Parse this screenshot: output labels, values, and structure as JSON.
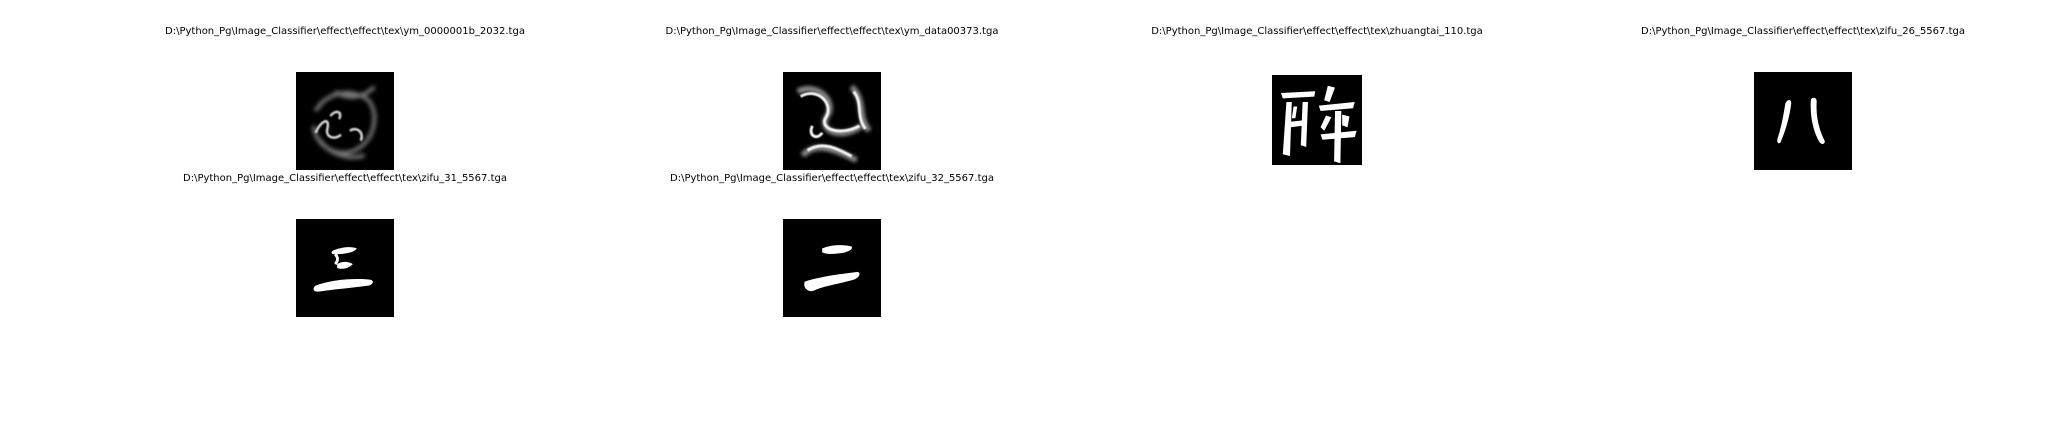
{
  "figure": {
    "images": [
      {
        "path": "D:\\Python_Pg\\Image_Classifier\\effect\\effect\\tex\\ym_0000001b_2032.tga",
        "thumb": "smoke-texture-1"
      },
      {
        "path": "D:\\Python_Pg\\Image_Classifier\\effect\\effect\\tex\\ym_data00373.tga",
        "thumb": "smoke-texture-2"
      },
      {
        "path": "D:\\Python_Pg\\Image_Classifier\\effect\\effect\\tex\\zhuangtai_110.tga",
        "thumb": "calligraphy-zui"
      },
      {
        "path": "D:\\Python_Pg\\Image_Classifier\\effect\\effect\\tex\\zifu_26_5567.tga",
        "thumb": "calligraphy-ba"
      },
      {
        "path": "D:\\Python_Pg\\Image_Classifier\\effect\\effect\\tex\\zifu_31_5567.tga",
        "thumb": "calligraphy-san"
      },
      {
        "path": "D:\\Python_Pg\\Image_Classifier\\effect\\effect\\tex\\zifu_32_5567.tga",
        "thumb": "calligraphy-er"
      }
    ]
  }
}
